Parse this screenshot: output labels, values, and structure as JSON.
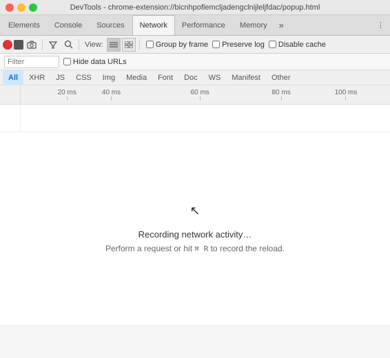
{
  "titleBar": {
    "title": "DevTools - chrome-extension://bicnhpoflemcljadengclnijleljfdac/popup.html"
  },
  "mainNav": {
    "tabs": [
      {
        "id": "elements",
        "label": "Elements",
        "active": false
      },
      {
        "id": "console",
        "label": "Console",
        "active": false
      },
      {
        "id": "sources",
        "label": "Sources",
        "active": false
      },
      {
        "id": "network",
        "label": "Network",
        "active": true
      },
      {
        "id": "performance",
        "label": "Performance",
        "active": false
      },
      {
        "id": "memory",
        "label": "Memory",
        "active": false
      }
    ],
    "moreLabel": "»",
    "overflowLabel": "⋮"
  },
  "toolbar": {
    "viewLabel": "View:",
    "groupByFrame": {
      "label": "Group by frame",
      "checked": false
    },
    "preserveLog": {
      "label": "Preserve log",
      "checked": false
    },
    "disableCache": {
      "label": "Disable cache",
      "checked": false
    }
  },
  "filterRow": {
    "filterPlaceholder": "Filter",
    "hideDataUrls": {
      "label": "Hide data URLs",
      "checked": false
    }
  },
  "typeTabs": [
    {
      "id": "all",
      "label": "All",
      "active": true
    },
    {
      "id": "xhr",
      "label": "XHR",
      "active": false
    },
    {
      "id": "js",
      "label": "JS",
      "active": false
    },
    {
      "id": "css",
      "label": "CSS",
      "active": false
    },
    {
      "id": "img",
      "label": "Img",
      "active": false
    },
    {
      "id": "media",
      "label": "Media",
      "active": false
    },
    {
      "id": "font",
      "label": "Font",
      "active": false
    },
    {
      "id": "doc",
      "label": "Doc",
      "active": false
    },
    {
      "id": "ws",
      "label": "WS",
      "active": false
    },
    {
      "id": "manifest",
      "label": "Manifest",
      "active": false
    },
    {
      "id": "other",
      "label": "Other",
      "active": false
    }
  ],
  "timeline": {
    "ticks": [
      {
        "label": "20 ms",
        "position": 10
      },
      {
        "label": "40 ms",
        "position": 22
      },
      {
        "label": "60 ms",
        "position": 46
      },
      {
        "label": "80 ms",
        "position": 68
      },
      {
        "label": "100 ms",
        "position": 85
      }
    ]
  },
  "emptyState": {
    "recordingText": "Recording network activity…",
    "shortcutText1": "Perform a request or hit ",
    "shortcutKey": "⌘ R",
    "shortcutText2": " to record the reload."
  }
}
